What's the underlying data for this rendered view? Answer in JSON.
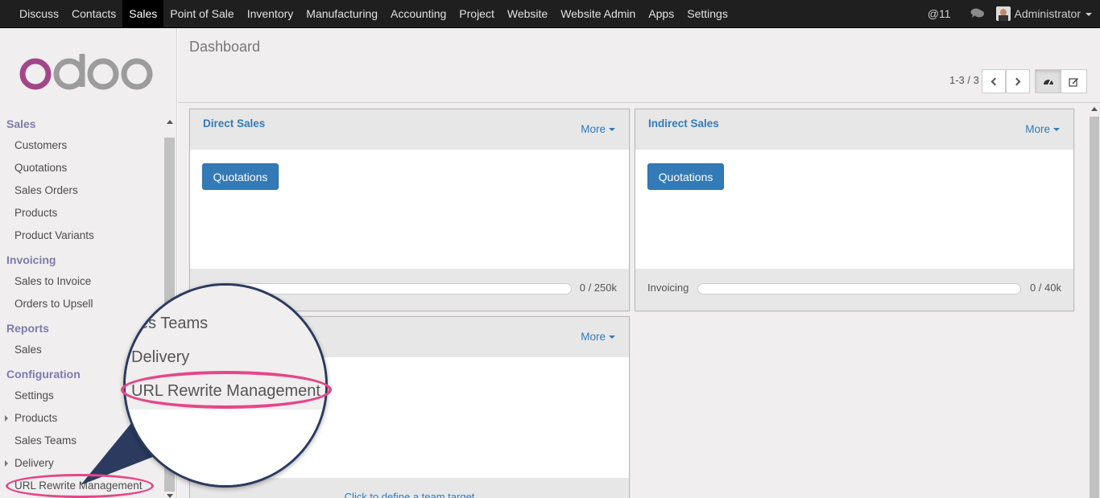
{
  "topbar": {
    "menu": [
      {
        "label": "Discuss",
        "active": false
      },
      {
        "label": "Contacts",
        "active": false
      },
      {
        "label": "Sales",
        "active": true
      },
      {
        "label": "Point of Sale",
        "active": false
      },
      {
        "label": "Inventory",
        "active": false
      },
      {
        "label": "Manufacturing",
        "active": false
      },
      {
        "label": "Accounting",
        "active": false
      },
      {
        "label": "Project",
        "active": false
      },
      {
        "label": "Website",
        "active": false
      },
      {
        "label": "Website Admin",
        "active": false
      },
      {
        "label": "Apps",
        "active": false
      },
      {
        "label": "Settings",
        "active": false
      }
    ],
    "mentions": "@11",
    "user": "Administrator"
  },
  "sidebar": {
    "sections": [
      {
        "title": "Sales",
        "items": [
          "Customers",
          "Quotations",
          "Sales Orders",
          "Products",
          "Product Variants"
        ]
      },
      {
        "title": "Invoicing",
        "items": [
          "Sales to Invoice",
          "Orders to Upsell"
        ]
      },
      {
        "title": "Reports",
        "items": [
          "Sales"
        ]
      },
      {
        "title": "Configuration",
        "items": [
          "Settings",
          "Products",
          "Sales Teams",
          "Delivery",
          "URL Rewrite Management"
        ]
      }
    ]
  },
  "control": {
    "breadcrumb": "Dashboard",
    "pager": "1-3 / 3"
  },
  "cards": [
    {
      "title": "Direct Sales",
      "more": "More",
      "button": "Quotations",
      "footer_value": "0 / 250k"
    },
    {
      "title": "Indirect Sales",
      "more": "More",
      "button": "Quotations",
      "footer_label": "Invoicing",
      "footer_value": "0 / 40k"
    },
    {
      "title": "",
      "more": "More",
      "footer_link": "Click to define a team target"
    }
  ],
  "zoom": {
    "items": [
      "Sales Teams",
      "Delivery",
      "URL Rewrite Management"
    ]
  },
  "colors": {
    "accent_blue": "#337ab7",
    "section_purple": "#7c7bad",
    "highlight_pink": "#e5468a",
    "callout_navy": "#2b3a5e"
  }
}
